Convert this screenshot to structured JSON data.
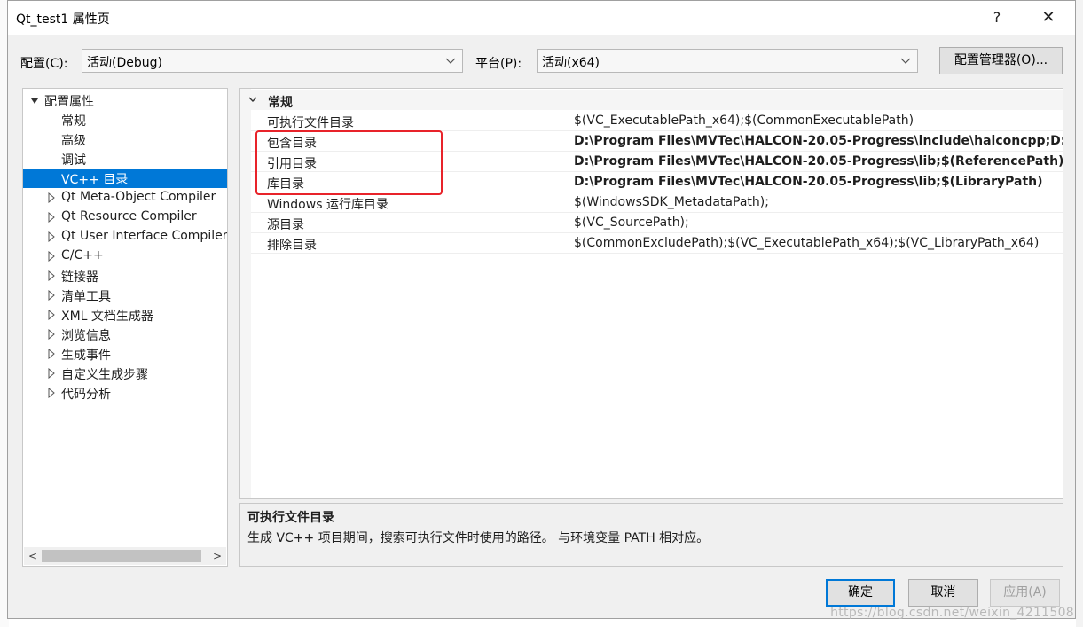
{
  "window": {
    "title": "Qt_test1 属性页",
    "help_label": "?",
    "close_label": "✕"
  },
  "config": {
    "label": "配置(C):",
    "value": "活动(Debug)"
  },
  "platform": {
    "label": "平台(P):",
    "value": "活动(x64)"
  },
  "config_manager_label": "配置管理器(O)...",
  "tree": {
    "root_label": "配置属性",
    "children": [
      {
        "label": "常规",
        "expandable": false
      },
      {
        "label": "高级",
        "expandable": false
      },
      {
        "label": "调试",
        "expandable": false
      },
      {
        "label": "VC++ 目录",
        "expandable": false,
        "selected": true
      },
      {
        "label": "Qt Meta-Object Compiler",
        "expandable": true
      },
      {
        "label": "Qt Resource Compiler",
        "expandable": true
      },
      {
        "label": "Qt User Interface Compiler",
        "expandable": true
      },
      {
        "label": "C/C++",
        "expandable": true
      },
      {
        "label": "链接器",
        "expandable": true
      },
      {
        "label": "清单工具",
        "expandable": true
      },
      {
        "label": "XML 文档生成器",
        "expandable": true
      },
      {
        "label": "浏览信息",
        "expandable": true
      },
      {
        "label": "生成事件",
        "expandable": true
      },
      {
        "label": "自定义生成步骤",
        "expandable": true
      },
      {
        "label": "代码分析",
        "expandable": true
      }
    ]
  },
  "grid": {
    "category": "常规",
    "rows": [
      {
        "name": "可执行文件目录",
        "value": "$(VC_ExecutablePath_x64);$(CommonExecutablePath)",
        "bold": false
      },
      {
        "name": "包含目录",
        "value": "D:\\Program Files\\MVTec\\HALCON-20.05-Progress\\include\\halconcpp;D:\\",
        "bold": true
      },
      {
        "name": "引用目录",
        "value": "D:\\Program Files\\MVTec\\HALCON-20.05-Progress\\lib;$(ReferencePath)",
        "bold": true
      },
      {
        "name": "库目录",
        "value": "D:\\Program Files\\MVTec\\HALCON-20.05-Progress\\lib;$(LibraryPath)",
        "bold": true
      },
      {
        "name": "Windows 运行库目录",
        "value": "$(WindowsSDK_MetadataPath);",
        "bold": false
      },
      {
        "name": "源目录",
        "value": "$(VC_SourcePath);",
        "bold": false
      },
      {
        "name": "排除目录",
        "value": "$(CommonExcludePath);$(VC_ExecutablePath_x64);$(VC_LibraryPath_x64)",
        "bold": false
      }
    ]
  },
  "description": {
    "title": "可执行文件目录",
    "text": "生成 VC++ 项目期间，搜索可执行文件时使用的路径。 与环境变量 PATH 相对应。"
  },
  "buttons": {
    "ok": "确定",
    "cancel": "取消",
    "apply": "应用(A)"
  },
  "watermark": "https://blog.csdn.net/weixin_4211508",
  "colors": {
    "selection": "#0078d7",
    "highlight_box": "#e8232a",
    "ok_border": "#0078d7"
  }
}
